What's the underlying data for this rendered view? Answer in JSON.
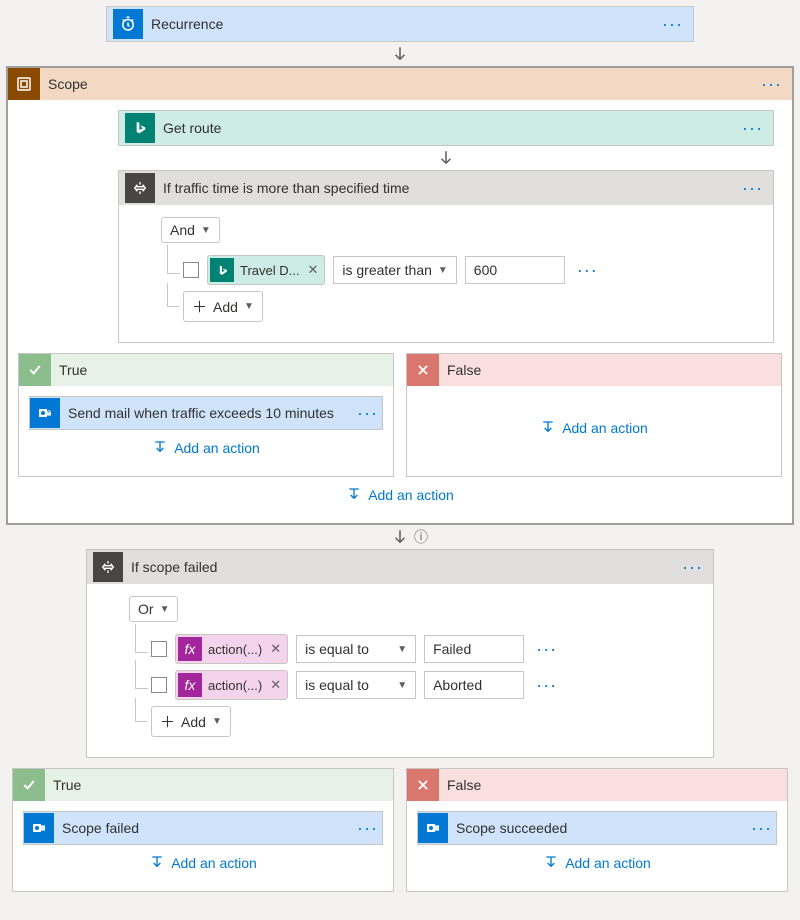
{
  "recurrence": {
    "label": "Recurrence"
  },
  "scope": {
    "label": "Scope"
  },
  "getRoute": {
    "label": "Get route"
  },
  "cond1": {
    "label": "If traffic time is more than specified time",
    "op": "And",
    "token": "Travel D...",
    "cmp": "is greater than",
    "val": "600",
    "add": "Add"
  },
  "trueLbl": "True",
  "falseLbl": "False",
  "sendMail": "Send mail when traffic exceeds 10 minutes",
  "addAction": "Add an action",
  "cond2": {
    "label": "If scope failed",
    "op": "Or",
    "fx": "action(...)",
    "cmp": "is equal to",
    "v1": "Failed",
    "v2": "Aborted",
    "add": "Add"
  },
  "scopeFailed": "Scope failed",
  "scopeSucceeded": "Scope succeeded"
}
